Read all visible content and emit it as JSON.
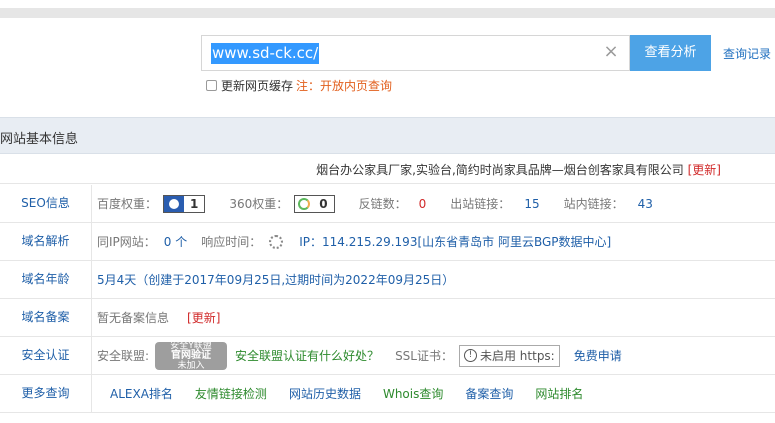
{
  "search": {
    "value": "www.sd-ck.cc/",
    "button_label": "查看分析",
    "history_label": "查询记录",
    "cache_label": "更新网页缓存",
    "cache_note": "注：开放内页查询"
  },
  "section_title": "网站基本信息",
  "site_title": "烟台办公家具厂家,实验台,简约时尚家具品牌—烟台创客家具有限公司",
  "update_label": "[更新]",
  "rows": {
    "seo": {
      "label": "SEO信息",
      "baidu_label": "百度权重：",
      "baidu_value": "1",
      "s360_label": "360权重：",
      "s360_value": "0",
      "backlinks_label": "反链数：",
      "backlinks_value": "0",
      "outlinks_label": "出站链接：",
      "outlinks_value": "15",
      "inlinks_label": "站内链接：",
      "inlinks_value": "43"
    },
    "dns": {
      "label": "域名解析",
      "same_ip_label": "同IP网站：",
      "same_ip_value": "0 个",
      "response_label": "响应时间：",
      "ip_text": "IP：114.215.29.193[山东省青岛市 阿里云BGP数据中心]"
    },
    "age": {
      "label": "域名年龄",
      "text": "5月4天（创建于2017年09月25日,过期时间为2022年09月25日）"
    },
    "icp": {
      "label": "域名备案",
      "text": "暂无备案信息",
      "update": "[更新]"
    },
    "security": {
      "label": "安全认证",
      "alliance_label": "安全联盟:",
      "seal_top": "安全Y联盟",
      "seal_mid": "官网验证",
      "seal_bottom": "未加入",
      "alliance_link": "安全联盟认证有什么好处？",
      "ssl_label": "SSL证书：",
      "ssl_status": "未启用 https:",
      "free_apply": "免费申请"
    },
    "more": {
      "label": "更多查询",
      "links": [
        "ALEXA排名",
        "友情链接检测",
        "网站历史数据",
        "Whois查询",
        "备案查询",
        "网站排名"
      ]
    }
  }
}
